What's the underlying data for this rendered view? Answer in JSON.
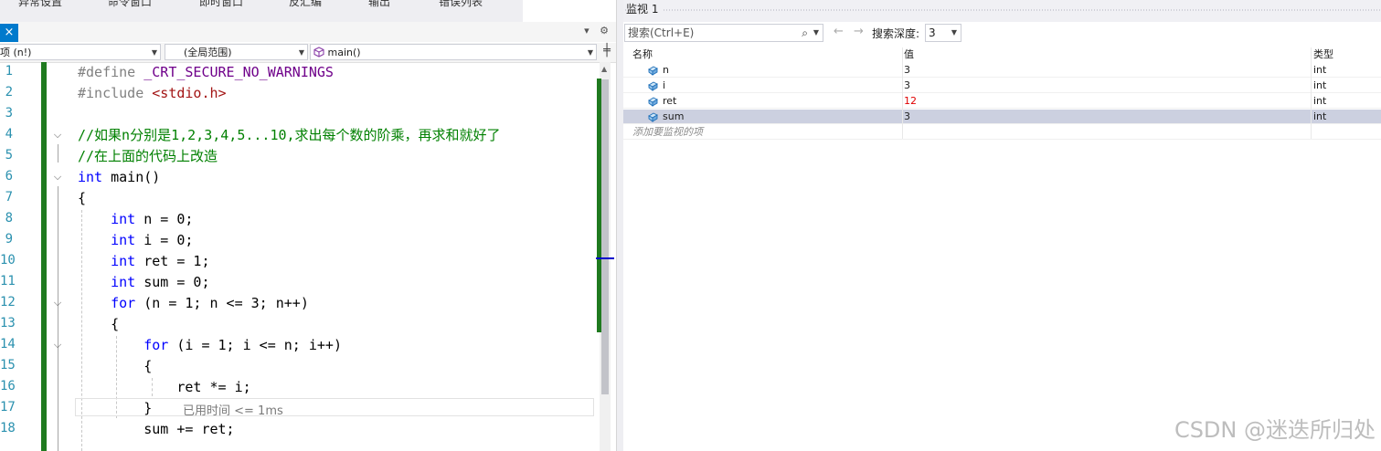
{
  "bottom_tabs": [
    "异常设置",
    "命令窗口",
    "即时窗口",
    "反汇编",
    "输出",
    "错误列表"
  ],
  "editor": {
    "close_glyph": "×",
    "pane_icons": "▾ ⚙",
    "nav": {
      "scope": "项 (n!)",
      "scope2": "(全局范围)",
      "function": "main()",
      "function_icon": "cube-icon"
    },
    "line_numbers": [
      "1",
      "2",
      "3",
      "4",
      "5",
      "6",
      "7",
      "8",
      "9",
      "10",
      "11",
      "12",
      "13",
      "14",
      "15",
      "16",
      "17",
      "18"
    ],
    "code_lines": [
      [
        [
          "pp",
          "#define "
        ],
        [
          "mac",
          "_CRT_SECURE_NO_WARNINGS"
        ]
      ],
      [
        [
          "pp",
          "#include "
        ],
        [
          "str",
          "<stdio.h>"
        ]
      ],
      [],
      [
        [
          "cm",
          "//如果n分别是1,2,3,4,5...10,求出每个数的阶乘，再求和就好了"
        ]
      ],
      [
        [
          "cm",
          "//在上面的代码上改造"
        ]
      ],
      [
        [
          "kw",
          "int"
        ],
        [
          "",
          " main()"
        ]
      ],
      [
        [
          "",
          "{"
        ]
      ],
      [
        [
          "",
          "    "
        ],
        [
          "kw",
          "int"
        ],
        [
          "",
          " n = 0;"
        ]
      ],
      [
        [
          "",
          "    "
        ],
        [
          "kw",
          "int"
        ],
        [
          "",
          " i = 0;"
        ]
      ],
      [
        [
          "",
          "    "
        ],
        [
          "kw",
          "int"
        ],
        [
          "",
          " ret = 1;"
        ]
      ],
      [
        [
          "",
          "    "
        ],
        [
          "kw",
          "int"
        ],
        [
          "",
          " sum = 0;"
        ]
      ],
      [
        [
          "",
          "    "
        ],
        [
          "kw",
          "for"
        ],
        [
          "",
          " (n = 1; n <= 3; n++)"
        ]
      ],
      [
        [
          "",
          "    {"
        ]
      ],
      [
        [
          "",
          "        "
        ],
        [
          "kw",
          "for"
        ],
        [
          "",
          " (i = 1; i <= n; i++)"
        ]
      ],
      [
        [
          "",
          "        {"
        ]
      ],
      [
        [
          "",
          "            ret *= i;"
        ]
      ],
      [
        [
          "",
          "        }"
        ]
      ],
      [
        [
          "",
          "        sum += ret;"
        ]
      ]
    ],
    "perf_tip": "已用时间 <= 1ms"
  },
  "watch": {
    "title": "监视 1",
    "search_placeholder": "搜索(Ctrl+E)",
    "search_icon": "search-icon",
    "back_arrow": "←",
    "forward_arrow": "→",
    "depth_label": "搜索深度:",
    "depth_value": "3",
    "columns": {
      "name": "名称",
      "value": "值",
      "type": "类型"
    },
    "rows": [
      {
        "name": "n",
        "value": "3",
        "type": "int",
        "changed": false,
        "selected": false
      },
      {
        "name": "i",
        "value": "3",
        "type": "int",
        "changed": false,
        "selected": false
      },
      {
        "name": "ret",
        "value": "12",
        "type": "int",
        "changed": true,
        "selected": false
      },
      {
        "name": "sum",
        "value": "3",
        "type": "int",
        "changed": false,
        "selected": true
      }
    ],
    "add_item": "添加要监视的项",
    "changed_color": "#e00000",
    "selected_color": "#ccd0e0"
  },
  "watermark": "CSDN @迷迭所归处"
}
